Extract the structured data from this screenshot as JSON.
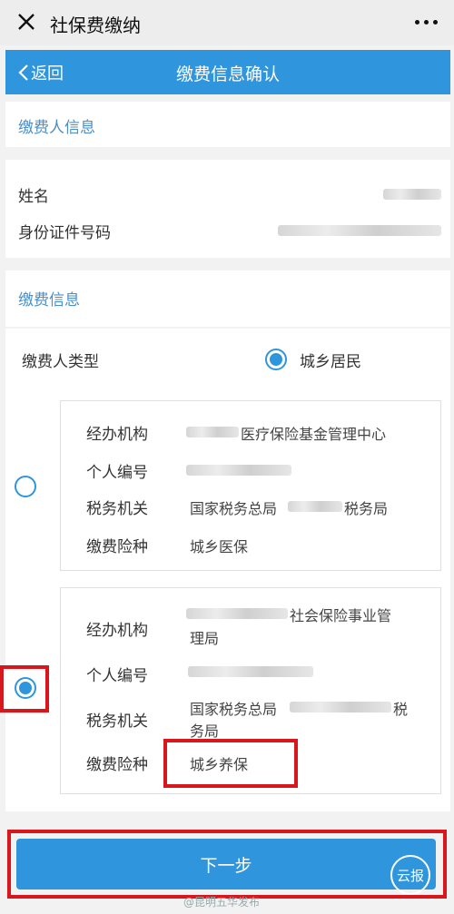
{
  "window": {
    "title": "社保费缴纳"
  },
  "nav": {
    "back_label": "返回",
    "title": "缴费信息确认"
  },
  "payer_section": {
    "heading": "缴费人信息",
    "name_label": "姓名",
    "id_label": "身份证件号码"
  },
  "pay_section": {
    "heading": "缴费信息",
    "payer_type_label": "缴费人类型",
    "payer_type_value": "城乡居民"
  },
  "option1": {
    "agency_label": "经办机构",
    "agency_value": "医疗保险基金管理中心",
    "personal_no_label": "个人编号",
    "tax_label": "税务机关",
    "tax_prefix": "国家税务总局",
    "tax_suffix": "税务局",
    "insurance_label": "缴费险种",
    "insurance_value": "城乡医保"
  },
  "option2": {
    "agency_label": "经办机构",
    "agency_value_line1": "社会保险事业管",
    "agency_value_line2": "理局",
    "personal_no_label": "个人编号",
    "tax_label": "税务机关",
    "tax_prefix": "国家税务总局",
    "tax_suffix_line1": "税",
    "tax_suffix_line2": "务局",
    "insurance_label": "缴费险种",
    "insurance_value": "城乡养保"
  },
  "next_button": {
    "label": "下一步"
  },
  "watermark": {
    "text": "@昆明五华发布",
    "logo": "云报"
  },
  "colors": {
    "accent": "#2f95dc",
    "highlight": "#d9161c",
    "section_heading": "#4a8fc9"
  }
}
